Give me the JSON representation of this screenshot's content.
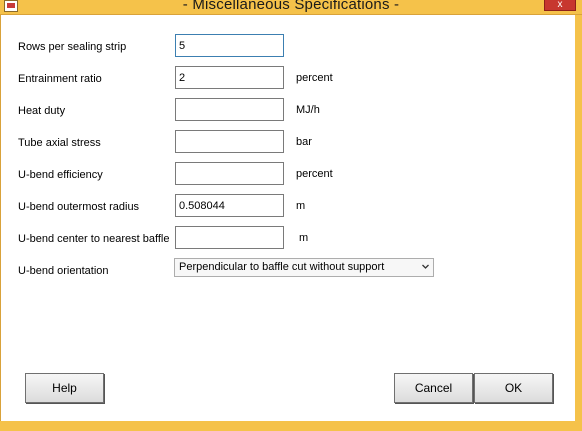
{
  "window": {
    "title": "- Miscellaneous Specifications -",
    "close_glyph": "x"
  },
  "fields": [
    {
      "label": "Rows per sealing strip",
      "value": "5",
      "unit": ""
    },
    {
      "label": "Entrainment ratio",
      "value": "2",
      "unit": "percent"
    },
    {
      "label": "Heat duty",
      "value": "",
      "unit": "MJ/h"
    },
    {
      "label": "Tube axial stress",
      "value": "",
      "unit": "bar"
    },
    {
      "label": "U-bend efficiency",
      "value": "",
      "unit": "percent"
    },
    {
      "label": "U-bend outermost radius",
      "value": "0.508044",
      "unit": "m"
    },
    {
      "label": "U-bend center to nearest baffle",
      "value": "",
      "unit": "m"
    }
  ],
  "orientation": {
    "label": "U-bend orientation",
    "selected": "Perpendicular to baffle cut without support"
  },
  "buttons": {
    "help": "Help",
    "cancel": "Cancel",
    "ok": "OK"
  },
  "colors": {
    "titlebar": "#f5c24a",
    "close": "#c7372f"
  }
}
